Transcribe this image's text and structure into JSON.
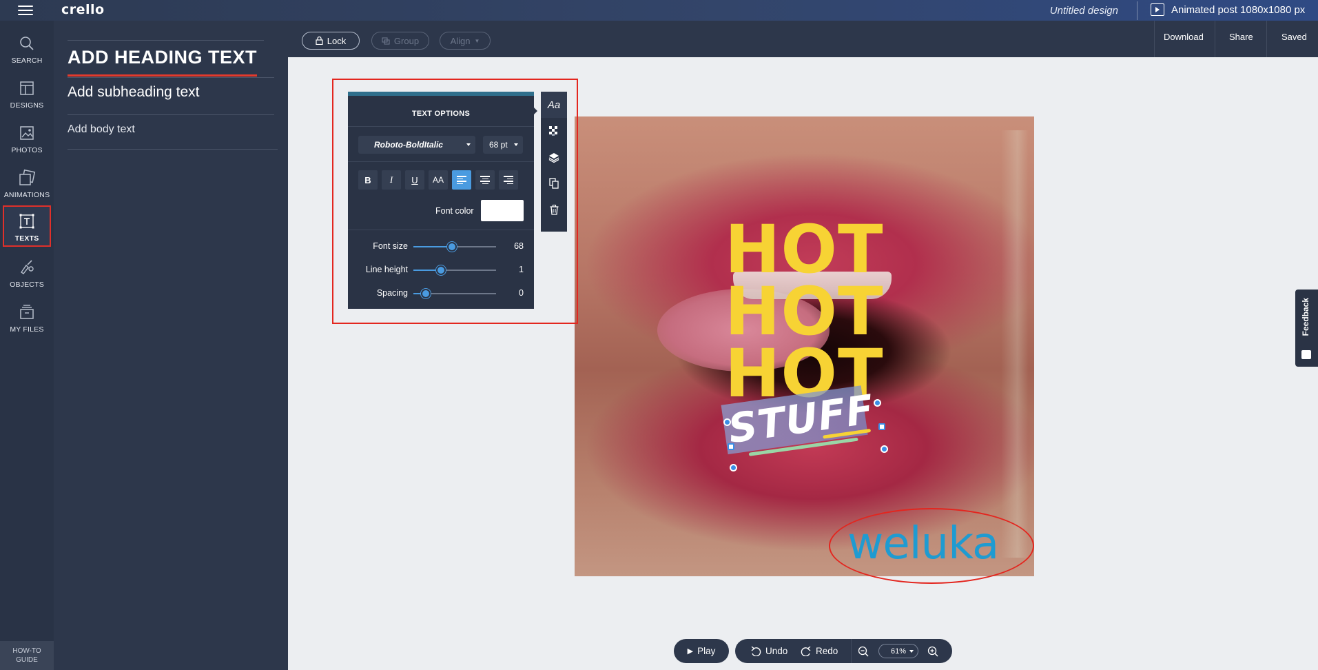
{
  "app": {
    "logo": "crello",
    "doc_title": "Untitled design",
    "format_label": "Animated post 1080x1080 px"
  },
  "rail": {
    "items": [
      {
        "label": "SEARCH",
        "icon": "search-icon"
      },
      {
        "label": "DESIGNS",
        "icon": "designs-icon"
      },
      {
        "label": "PHOTOS",
        "icon": "photos-icon"
      },
      {
        "label": "ANIMATIONS",
        "icon": "animations-icon"
      },
      {
        "label": "TEXTS",
        "icon": "texts-icon",
        "active": true
      },
      {
        "label": "OBJECTS",
        "icon": "objects-icon"
      },
      {
        "label": "MY FILES",
        "icon": "my-files-icon"
      }
    ],
    "howto_line1": "HOW-TO",
    "howto_line2": "GUIDE"
  },
  "panel": {
    "heading": "ADD HEADING TEXT",
    "subheading": "Add subheading text",
    "body": "Add body text"
  },
  "toolbar": {
    "lock": "Lock",
    "group": "Group",
    "align": "Align",
    "download": "Download",
    "share": "Share",
    "saved": "Saved"
  },
  "text_options": {
    "title": "TEXT OPTIONS",
    "font": "Roboto-BoldItalic",
    "size": "68 pt",
    "bold": "B",
    "italic": "I",
    "underline": "U",
    "caps": "AA",
    "font_color_label": "Font color",
    "font_color": "#ffffff",
    "font_size_label": "Font size",
    "font_size_value": "68",
    "font_size_level": 0.47,
    "line_height_label": "Line height",
    "line_height_value": "1",
    "line_height_level": 0.33,
    "spacing_label": "Spacing",
    "spacing_value": "0",
    "spacing_level": 0.15
  },
  "side_tools": {
    "text_tool": "Aa"
  },
  "canvas": {
    "hot_lines": [
      "HOT",
      "HOT",
      "HOT"
    ],
    "stuff": "STUFF",
    "watermark": "weluka"
  },
  "bottom": {
    "play": "Play",
    "undo": "Undo",
    "redo": "Redo",
    "zoom": "61%"
  },
  "feedback": "Feedback",
  "colors": {
    "accent": "#4a9be0",
    "highlight_red": "#e3261f",
    "hot_yellow": "#f7d334",
    "watermark_blue": "#1f9bd1"
  }
}
